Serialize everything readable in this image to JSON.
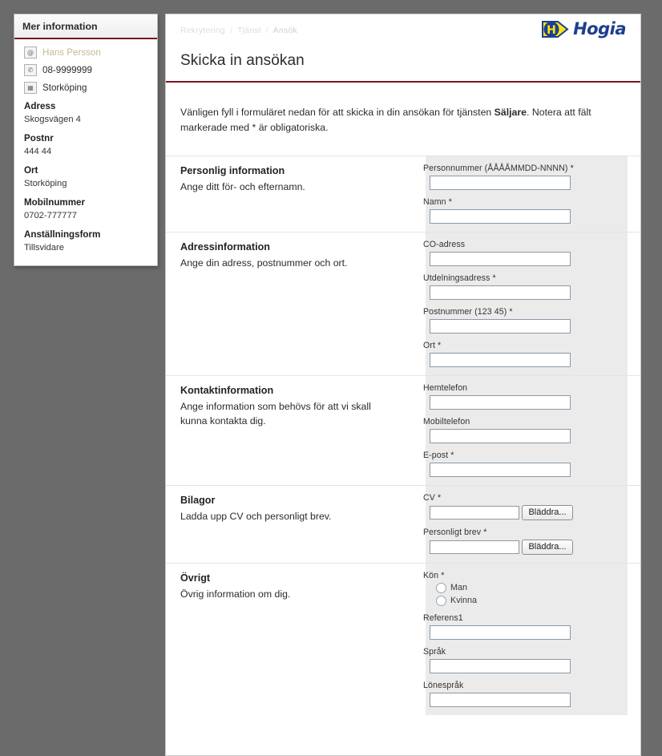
{
  "info_panel": {
    "title": "Mer information",
    "contacts": [
      {
        "icon": "email-icon",
        "glyph": "@",
        "text": "Hans Persson",
        "muted": true
      },
      {
        "icon": "phone-icon",
        "glyph": "✆",
        "text": "08-9999999",
        "muted": false
      },
      {
        "icon": "map-icon",
        "glyph": "▦",
        "text": "Storköping",
        "muted": false
      }
    ],
    "fields": [
      {
        "label": "Adress",
        "value": "Skogsvägen 4"
      },
      {
        "label": "Postnr",
        "value": "444 44"
      },
      {
        "label": "Ort",
        "value": "Storköping"
      },
      {
        "label": "Mobilnummer",
        "value": "0702-777777"
      },
      {
        "label": "Anställningsform",
        "value": "Tillsvidare"
      }
    ]
  },
  "header": {
    "breadcrumb": [
      "Rekrytering",
      "Tjänst",
      "Ansök"
    ],
    "breadcrumb_separator": "/",
    "logo_text": "Hogia",
    "logo_letter": "H",
    "page_title": "Skicka in ansökan"
  },
  "intro": {
    "part1": "Vänligen fyll i formuläret nedan för att skicka in din ansökan för tjänsten ",
    "job": "Säljare",
    "part2": ". Notera att fält markerade med * är obligatoriska."
  },
  "sections": [
    {
      "title": "Personlig information",
      "desc": "Ange ditt för- och efternamn.",
      "fields": [
        {
          "type": "text",
          "label": "Personnummer (ÅÅÅÅMMDD-NNNN) *",
          "value": ""
        },
        {
          "type": "text",
          "label": "Namn *",
          "value": ""
        }
      ]
    },
    {
      "title": "Adressinformation",
      "desc": "Ange din adress, postnummer och ort.",
      "fields": [
        {
          "type": "text",
          "label": "CO-adress",
          "value": ""
        },
        {
          "type": "text",
          "label": "Utdelningsadress *",
          "value": ""
        },
        {
          "type": "text",
          "label": "Postnummer (123 45) *",
          "value": ""
        },
        {
          "type": "text",
          "label": "Ort *",
          "value": ""
        }
      ]
    },
    {
      "title": "Kontaktinformation",
      "desc": "Ange information som behövs för att vi skall kunna kontakta dig.",
      "fields": [
        {
          "type": "text",
          "label": "Hemtelefon",
          "value": ""
        },
        {
          "type": "text",
          "label": "Mobiltelefon",
          "value": ""
        },
        {
          "type": "text",
          "label": "E-post *",
          "value": ""
        }
      ]
    },
    {
      "title": "Bilagor",
      "desc": "Ladda upp CV och personligt brev.",
      "fields": [
        {
          "type": "file",
          "label": "CV *",
          "value": "",
          "button": "Bläddra..."
        },
        {
          "type": "file",
          "label": "Personligt brev *",
          "value": "",
          "button": "Bläddra..."
        }
      ]
    },
    {
      "title": "Övrigt",
      "desc": "Övrig information om dig.",
      "fields": [
        {
          "type": "radio",
          "label": "Kön *",
          "options": [
            "Man",
            "Kvinna"
          ]
        },
        {
          "type": "text",
          "label": "Referens1",
          "value": ""
        },
        {
          "type": "text",
          "label": "Språk",
          "value": ""
        },
        {
          "type": "text",
          "label": "Lönespråk",
          "value": ""
        }
      ]
    }
  ],
  "colors": {
    "accent_rule": "#7b1520",
    "brand_blue": "#1d3f8f",
    "brand_yellow": "#fbe216",
    "panel_grey": "#ebebeb",
    "page_backdrop": "#6b6b6b"
  }
}
